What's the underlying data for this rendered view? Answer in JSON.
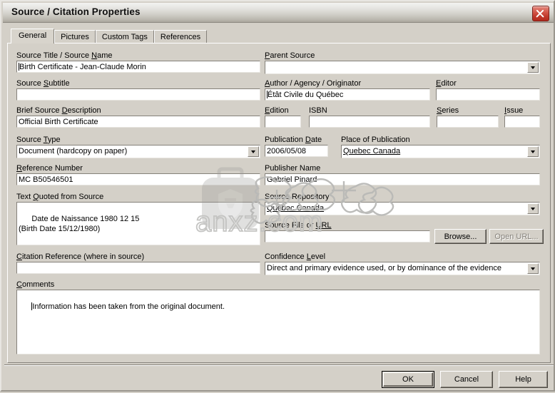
{
  "window": {
    "title": "Source / Citation Properties",
    "close_icon": "close-icon"
  },
  "tabs": [
    {
      "label": "General",
      "active": true
    },
    {
      "label": "Pictures",
      "active": false
    },
    {
      "label": "Custom Tags",
      "active": false
    },
    {
      "label": "References",
      "active": false
    }
  ],
  "fields": {
    "source_title": {
      "label_pre": "Source Title / Source ",
      "label_key": "N",
      "label_post": "ame",
      "value": "Birth Certificate - Jean-Claude Morin"
    },
    "source_subtitle": {
      "label_pre": "Source ",
      "label_key": "S",
      "label_post": "ubtitle",
      "value": ""
    },
    "brief_description": {
      "label_pre": "Brief Source ",
      "label_key": "D",
      "label_post": "escription",
      "value": "Official Birth Certificate"
    },
    "source_type": {
      "label_pre": "Source ",
      "label_key": "T",
      "label_post": "ype",
      "value": "Document (hardcopy on paper)"
    },
    "reference_number": {
      "label_pre": "",
      "label_key": "R",
      "label_post": "eference Number",
      "value": "MC B50546501"
    },
    "text_quoted": {
      "label_pre": "Text ",
      "label_key": "Q",
      "label_post": "uoted from Source",
      "value": "Date de Naissance 1980 12 15\n(Birth Date 15/12/1980)"
    },
    "citation_reference": {
      "label_pre": "",
      "label_key": "C",
      "label_post": "itation Reference (where in source)",
      "value": ""
    },
    "parent_source": {
      "label_pre": "",
      "label_key": "P",
      "label_post": "arent Source",
      "value": ""
    },
    "author": {
      "label_pre": "",
      "label_key": "A",
      "label_post": "uthor / Agency / Originator",
      "value": "Étât Civile du Québec"
    },
    "editor": {
      "label_pre": "",
      "label_key": "E",
      "label_post": "ditor",
      "value": ""
    },
    "edition": {
      "label_pre": "",
      "label_key": "E",
      "label_post": "dition",
      "value": ""
    },
    "isbn": {
      "label_pre": "ISBN",
      "label_key": "",
      "label_post": "",
      "value": ""
    },
    "series": {
      "label_pre": "",
      "label_key": "S",
      "label_post": "eries",
      "value": ""
    },
    "issue": {
      "label_pre": "",
      "label_key": "I",
      "label_post": "ssue",
      "value": ""
    },
    "publication_date": {
      "label_pre": "Publication ",
      "label_key": "D",
      "label_post": "ate",
      "value": "2006/05/08"
    },
    "place_of_publication": {
      "label_pre": "Place of Publication",
      "label_key": "",
      "label_post": "",
      "value": "Quebec Canada"
    },
    "publisher_name": {
      "label_pre": "Publisher Name",
      "label_key": "",
      "label_post": "",
      "value": "Gabriel Pinard"
    },
    "source_repository": {
      "label_pre": "Source Repository",
      "label_key": "",
      "label_post": "",
      "value": "Quebec Canada"
    },
    "source_file_url": {
      "label_pre": "Source File or ",
      "label_key": "URL",
      "label_post": "",
      "value": ""
    },
    "confidence_level": {
      "label_pre": "Confidence ",
      "label_key": "L",
      "label_post": "evel",
      "value": "Direct and primary evidence used, or by dominance of the evidence"
    },
    "comments": {
      "label_pre": "",
      "label_key": "C",
      "label_post": "omments",
      "value": "Information has been taken from the original document."
    }
  },
  "buttons": {
    "browse": "Browse...",
    "open_url": "Open URL...",
    "ok": "OK",
    "cancel": "Cancel",
    "help": "Help"
  },
  "watermark": {
    "text": "anxz.com"
  },
  "colors": {
    "dialog_face": "#d4d0c8",
    "field_bg": "#ffffff",
    "titlebar_light": "#f3f3f1",
    "titlebar_dark": "#aaa69c",
    "close_red": "#c0392c",
    "shadow": "#85817a",
    "disabled_text": "#85817a"
  }
}
